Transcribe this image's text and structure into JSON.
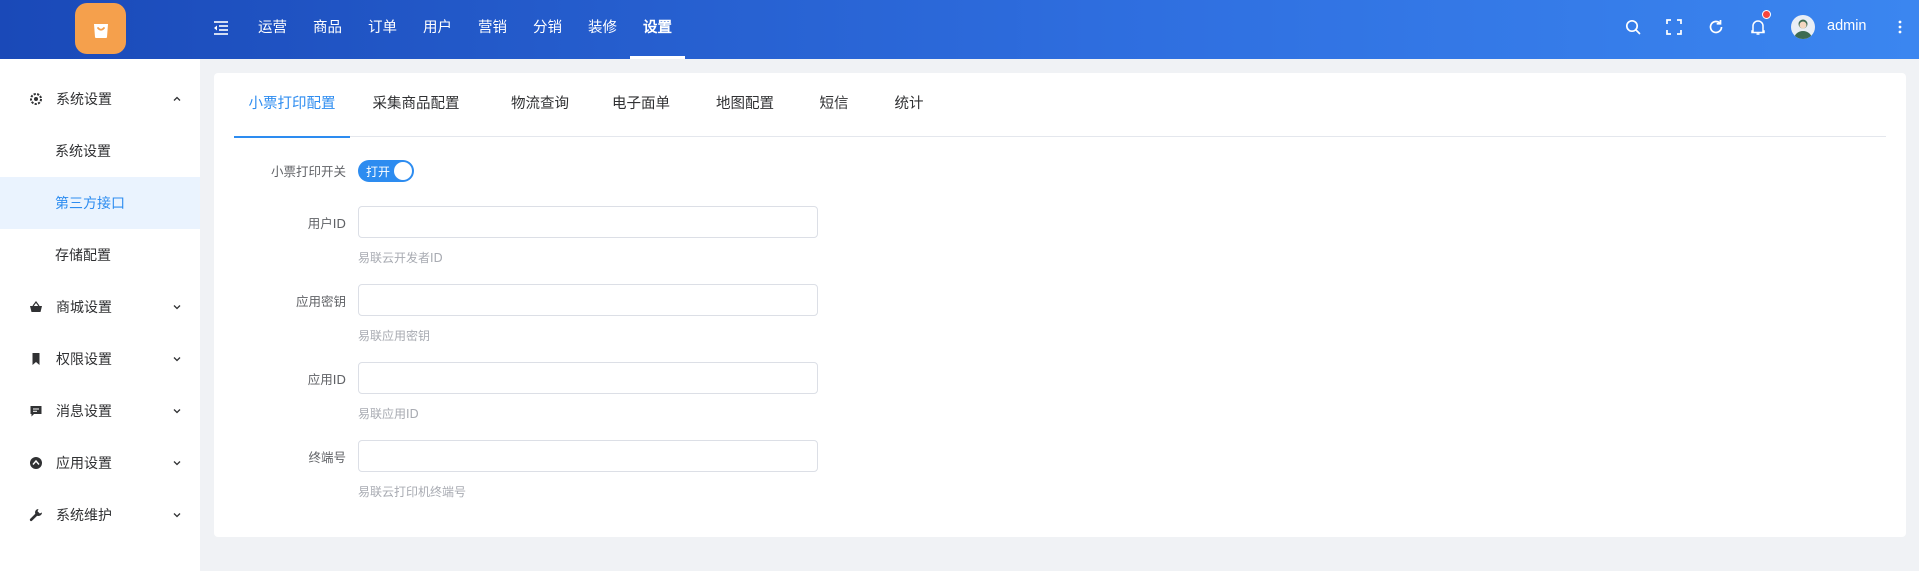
{
  "header": {
    "nav": [
      "运营",
      "商品",
      "订单",
      "用户",
      "营销",
      "分销",
      "装修",
      "设置"
    ],
    "active_nav": "设置",
    "username": "admin",
    "icons": [
      "collapse-icon",
      "search-icon",
      "fullscreen-icon",
      "refresh-icon",
      "bell-icon",
      "more-vertical-icon"
    ],
    "accent": "#2d8cf0"
  },
  "sidebar": {
    "groups": [
      {
        "label": "系统设置",
        "icon": "gear-icon",
        "expanded": true,
        "children": [
          {
            "label": "系统设置",
            "active": false
          },
          {
            "label": "第三方接口",
            "active": true
          },
          {
            "label": "存储配置",
            "active": false
          }
        ]
      },
      {
        "label": "商城设置",
        "icon": "basket-icon",
        "expanded": false
      },
      {
        "label": "权限设置",
        "icon": "bookmark-icon",
        "expanded": false
      },
      {
        "label": "消息设置",
        "icon": "message-icon",
        "expanded": false
      },
      {
        "label": "应用设置",
        "icon": "app-icon",
        "expanded": false
      },
      {
        "label": "系统维护",
        "icon": "wrench-icon",
        "expanded": false
      }
    ]
  },
  "tabs": [
    "小票打印配置",
    "采集商品配置",
    "物流查询",
    "电子面单",
    "地图配置",
    "短信",
    "统计"
  ],
  "active_tab": "小票打印配置",
  "form": {
    "switch_label": "小票打印开关",
    "switch_text": "打开",
    "switch_on": true,
    "fields": [
      {
        "label": "用户ID",
        "value": "",
        "help": "易联云开发者ID"
      },
      {
        "label": "应用密钥",
        "value": "",
        "help": "易联应用密钥"
      },
      {
        "label": "应用ID",
        "value": "",
        "help": "易联应用ID"
      },
      {
        "label": "终端号",
        "value": "",
        "help": "易联云打印机终端号"
      }
    ]
  }
}
